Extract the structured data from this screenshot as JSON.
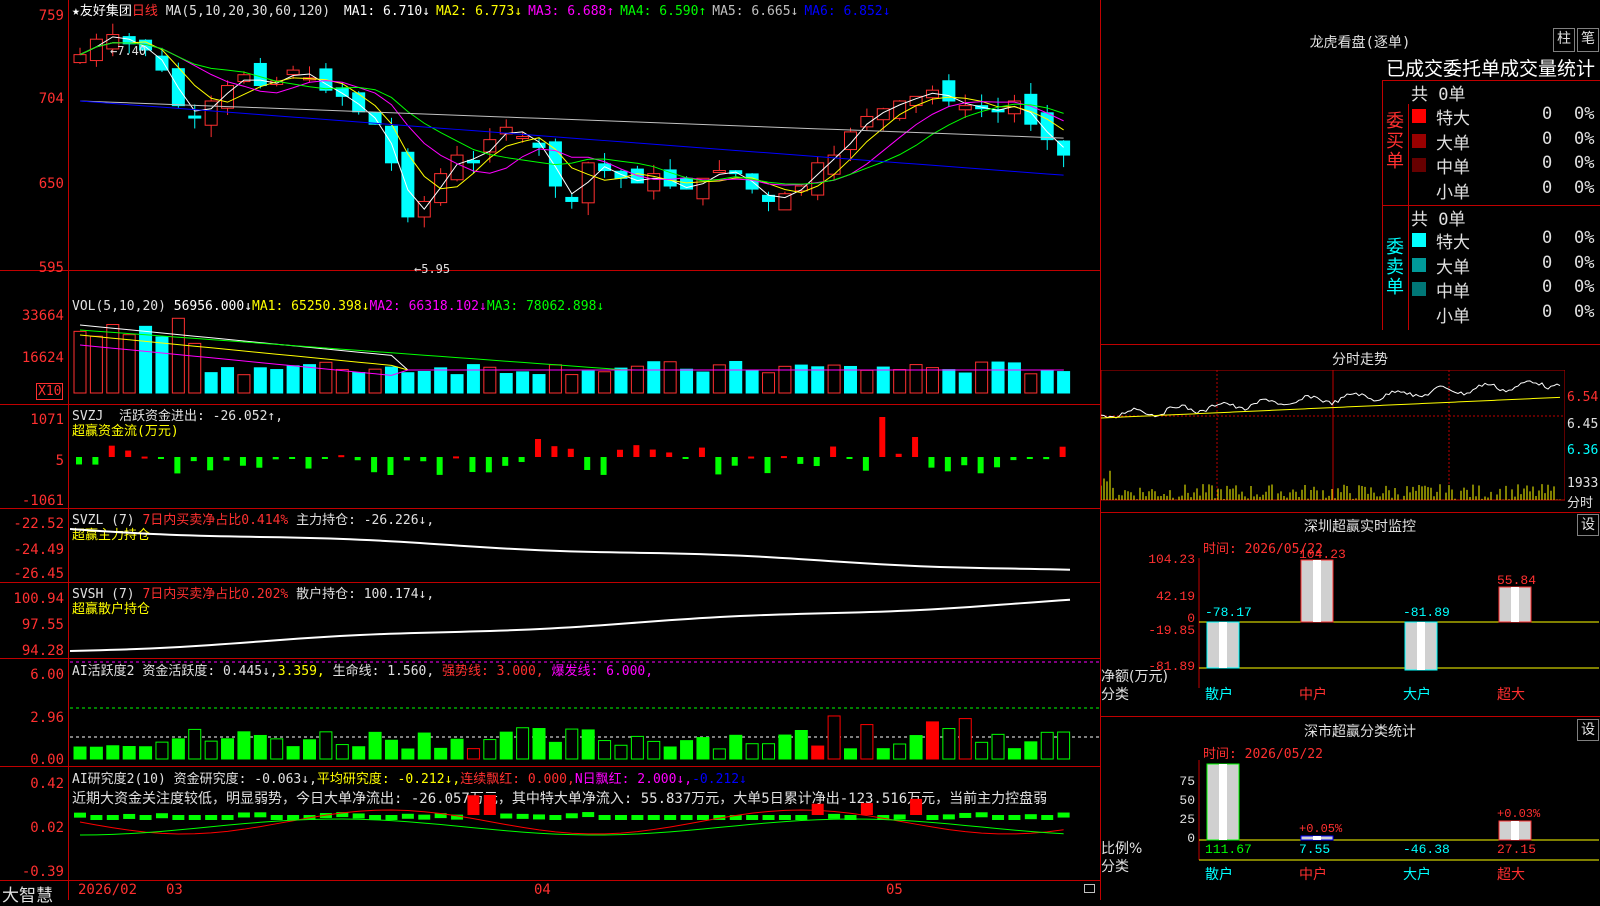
{
  "header": {
    "star": "★",
    "stock_name": "友好集团",
    "period": "日线",
    "ma_label": "MA(5,10,20,30,60,120)",
    "ma_items": [
      {
        "text": "MA1: 6.710↓",
        "color": "#ffffff"
      },
      {
        "text": "MA2: 6.773↓",
        "color": "#ffff00"
      },
      {
        "text": "MA3: 6.688↑",
        "color": "#ff00ff"
      },
      {
        "text": "MA4: 6.590↑",
        "color": "#00ff00"
      },
      {
        "text": "MA5: 6.665↓",
        "color": "#c0c0c0"
      },
      {
        "text": "MA6: 6.852↓",
        "color": "#0000ff"
      }
    ]
  },
  "price_axis": [
    "759",
    "704",
    "650",
    "595"
  ],
  "price_annotations": {
    "high": "7.40",
    "low": "5.95"
  },
  "volume": {
    "header": "VOL(5,10,20)",
    "value": "56956.000↓",
    "ma1": "MA1: 65250.398↓",
    "ma2": "MA2: 66318.102↓",
    "ma3": "MA3: 78062.898↓",
    "axis": [
      "33664",
      "16624"
    ],
    "unit": "X10"
  },
  "svzj": {
    "header": "SVZJ",
    "line1": "活跃资金进出: -26.052↑,",
    "line2": "超赢资金流(万元)",
    "axis": [
      "1071",
      "5",
      "-1061"
    ]
  },
  "svzl": {
    "header": "SVZL (7)",
    "ratio": "7日内买卖净占比0.414%",
    "hold": "主力持仓: -26.226↓,",
    "line2": "超赢主力持仓",
    "axis": [
      "-22.52",
      "-24.49",
      "-26.45"
    ]
  },
  "svsh": {
    "header": "SVSH (7)",
    "ratio": "7日内买卖净占比0.202%",
    "hold": "散户持仓: 100.174↓,",
    "line2": "超赢散户持仓",
    "axis": [
      "100.94",
      "97.55",
      "94.28"
    ]
  },
  "ai_active": {
    "header": "AI活跃度2",
    "a": "资金活跃度: 0.445↓,",
    "b": "3.359,",
    "c": "生命线: 1.560,",
    "d": "强势线: 3.000,",
    "e": "爆发线: 6.000,",
    "axis": [
      "6.00",
      "2.96",
      "0.00"
    ]
  },
  "ai_research": {
    "header": "AI研究度2(10)",
    "a": "资金研究度: -0.063↓,",
    "b": "平均研究度: -0.212↓,",
    "c": "连续飘红: 0.000,",
    "d": "N日飘红: 2.000↓,",
    "e": "-0.212↓",
    "summary": "近期大资金关注度较低，明显弱势，今日大单净流出: -26.057万元，其中特大单净流入: 55.837万元，大单5日累计净出-123.516万元，当前主力控盘弱",
    "axis": [
      "0.42",
      "0.02",
      "-0.39"
    ]
  },
  "bottom_bar": {
    "brand": "大智慧",
    "dates": [
      "2026/02",
      "03",
      "04",
      "05"
    ]
  },
  "dragon": {
    "title": "龙虎看盘(逐单)",
    "btn1": "柱",
    "btn2": "笔",
    "subtitle": "已成交委托单成交量统计",
    "buy_label": "委买单",
    "sell_label": "委卖单",
    "buy_total": "共 0单",
    "sell_total": "共 0单",
    "buy_rows": [
      {
        "name": "特大",
        "vol": "0",
        "pct": "0%",
        "color": "#ff0000"
      },
      {
        "name": "大单",
        "vol": "0",
        "pct": "0%",
        "color": "#990000"
      },
      {
        "name": "中单",
        "vol": "0",
        "pct": "0%",
        "color": "#660000"
      },
      {
        "name": "小单",
        "vol": "0",
        "pct": "0%",
        "color": "#000000"
      }
    ],
    "sell_rows": [
      {
        "name": "特大",
        "vol": "0",
        "pct": "0%",
        "color": "#00ffff"
      },
      {
        "name": "大单",
        "vol": "0",
        "pct": "0%",
        "color": "#009999"
      },
      {
        "name": "中单",
        "vol": "0",
        "pct": "0%",
        "color": "#007777"
      },
      {
        "name": "小单",
        "vol": "0",
        "pct": "0%",
        "color": "#000000"
      }
    ]
  },
  "intraday": {
    "title": "分时走势",
    "axis": [
      "6.54",
      "6.45",
      "6.36"
    ],
    "vol_axis": [
      "1933",
      "分时"
    ]
  },
  "sz_monitor": {
    "title": "深圳超赢实时监控",
    "btn": "设",
    "time": "时间: 2026/05/22",
    "axis": [
      "104.23",
      "42.19",
      "0",
      "-19.85",
      "-81.89"
    ],
    "y_label": "净额(万元)",
    "x_label": "分类",
    "categories": [
      "散户",
      "中户",
      "大户",
      "超大"
    ],
    "values": [
      "-78.17",
      "104.23",
      "-81.89",
      "55.84"
    ]
  },
  "sz_class": {
    "title": "深市超赢分类统计",
    "btn": "设",
    "time": "时间: 2026/05/22",
    "axis": [
      "75",
      "50",
      "25",
      "0"
    ],
    "y_label": "比例%",
    "x_label": "分类",
    "categories": [
      "散户",
      "中户",
      "大户",
      "超大"
    ],
    "pct_labels": [
      "",
      "+0.05%",
      "",
      "+0.03%"
    ],
    "values": [
      "111.67",
      "7.55",
      "-46.38",
      "27.15"
    ]
  }
}
